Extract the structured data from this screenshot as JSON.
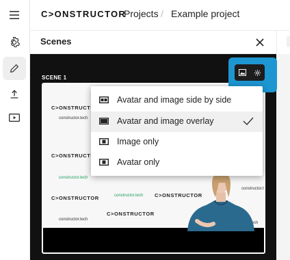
{
  "brand": {
    "logo_text": "C>ONSTRUCTOR",
    "accent": "#1d96d1",
    "url": "constructor.tech"
  },
  "sidebar": {
    "items": [
      {
        "name": "menu",
        "icon": "hamburger-icon"
      },
      {
        "name": "settings",
        "icon": "gear-icon"
      },
      {
        "name": "edit",
        "icon": "pencil-icon",
        "active": true
      },
      {
        "name": "export",
        "icon": "upload-icon"
      },
      {
        "name": "preview",
        "icon": "play-icon"
      }
    ]
  },
  "breadcrumb": {
    "items": [
      "Projects",
      "Example project"
    ],
    "separator": "/"
  },
  "panel": {
    "title": "Scenes"
  },
  "scene": {
    "label": "SCENE 1"
  },
  "layout_menu": {
    "items": [
      {
        "label": "Avatar and image side by side",
        "icon": "side-by-side-icon"
      },
      {
        "label": "Avatar and image overlay",
        "icon": "overlay-icon",
        "selected": true
      },
      {
        "label": "Image only",
        "icon": "image-only-icon"
      },
      {
        "label": "Avatar only",
        "icon": "avatar-only-icon"
      }
    ]
  }
}
